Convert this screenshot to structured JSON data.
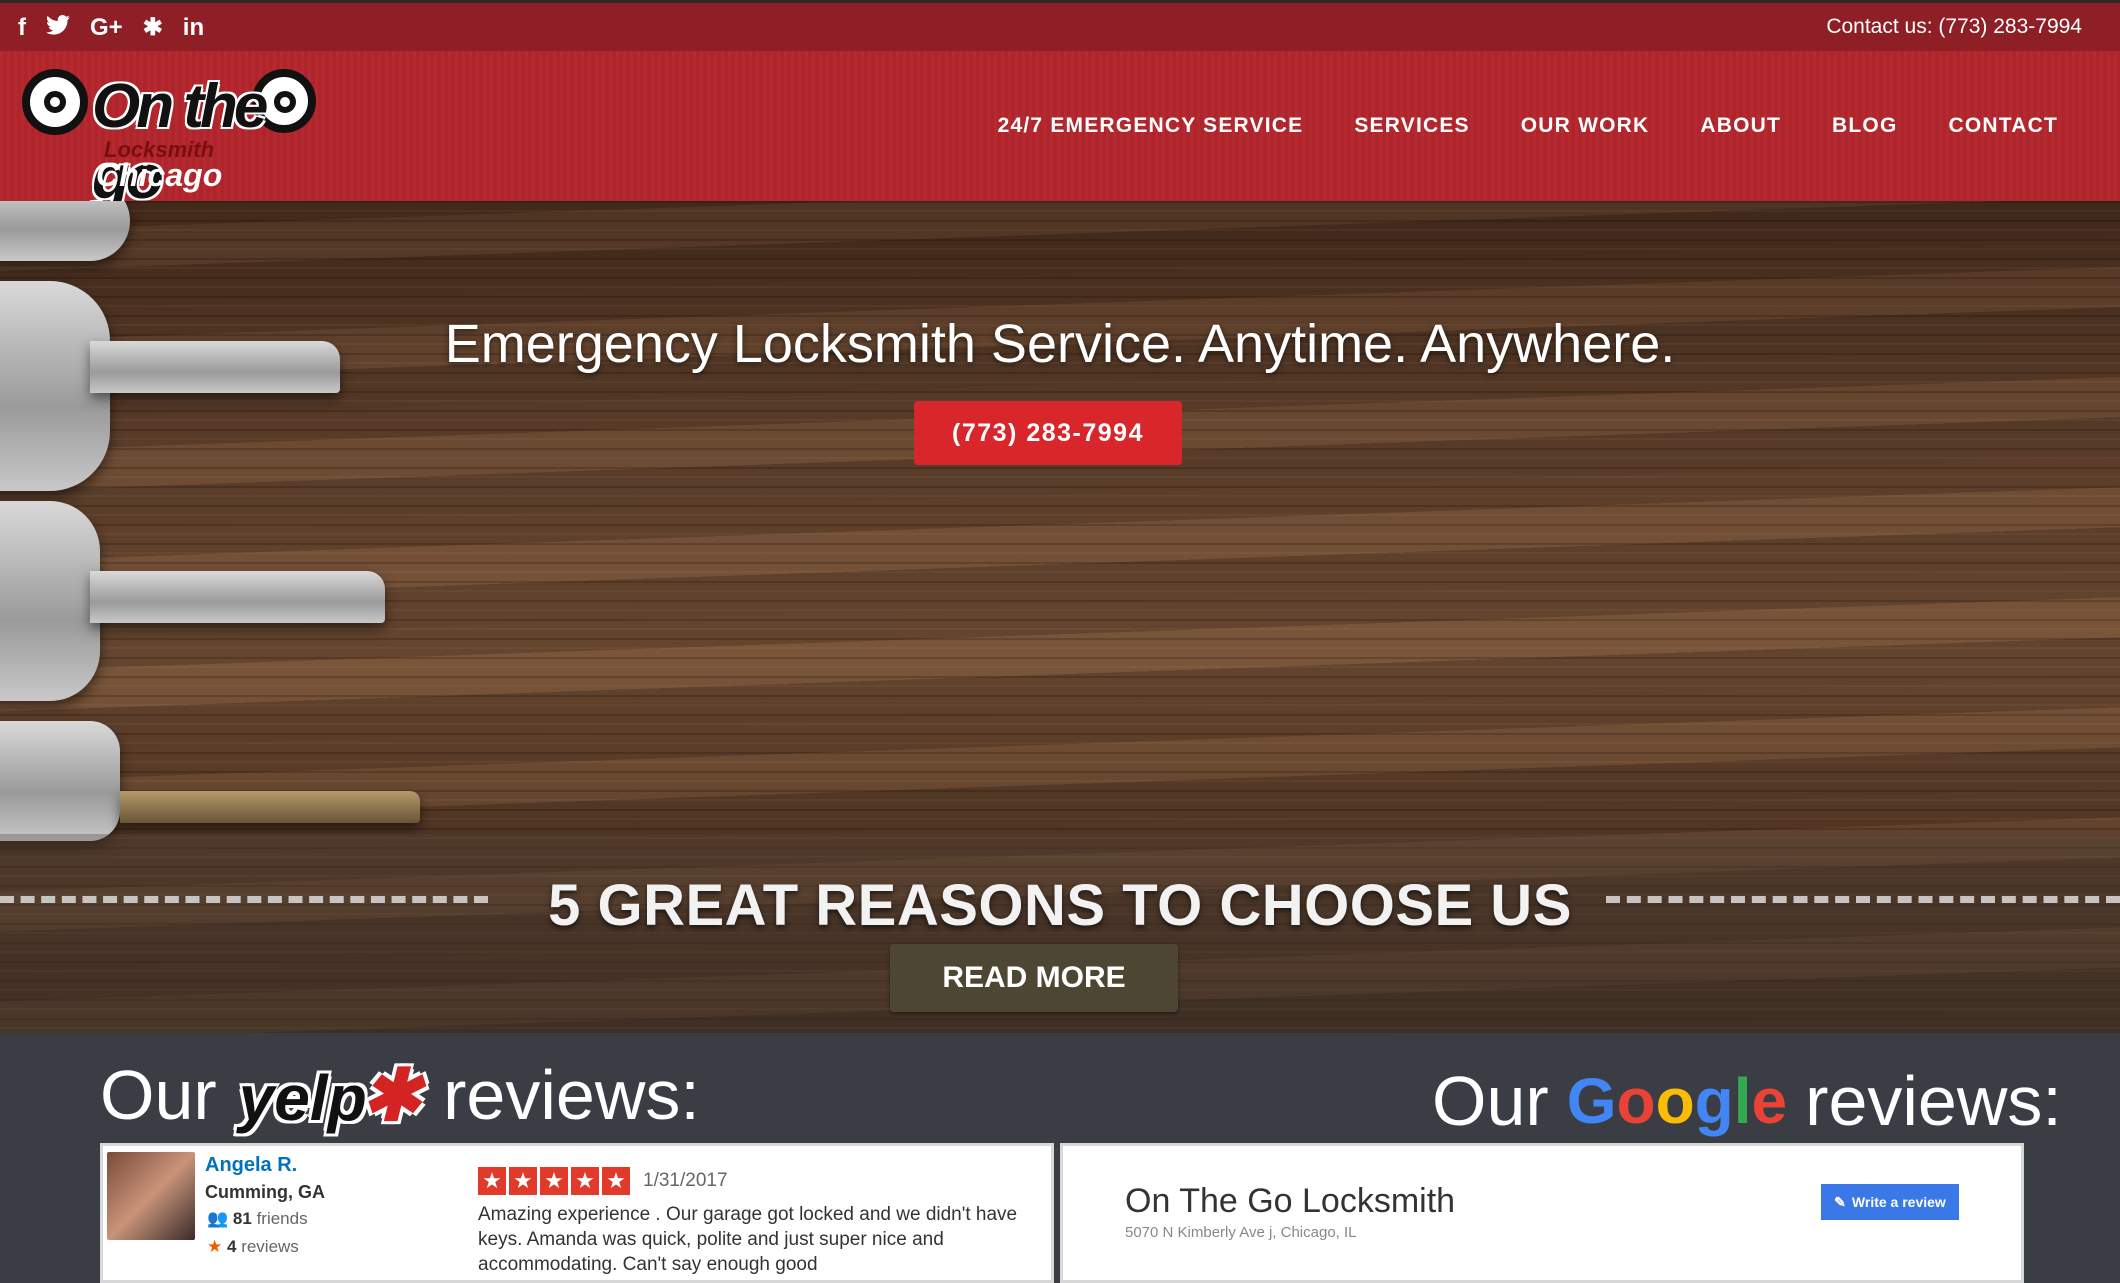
{
  "topbar": {
    "social": [
      {
        "icon": "facebook-icon",
        "glyph": "f"
      },
      {
        "icon": "twitter-icon",
        "glyph": "🐦"
      },
      {
        "icon": "google-plus-icon",
        "glyph": "G+"
      },
      {
        "icon": "yelp-icon",
        "glyph": "✱"
      },
      {
        "icon": "linkedin-icon",
        "glyph": "in"
      }
    ],
    "contact": "Contact us: (773) 283-7994"
  },
  "logo": {
    "wordmark": "On the go",
    "line2": "Locksmith",
    "line3": "Chicago"
  },
  "nav": {
    "items": [
      "24/7 EMERGENCY SERVICE",
      "SERVICES",
      "OUR WORK",
      "ABOUT",
      "BLOG",
      "CONTACT"
    ]
  },
  "hero": {
    "title": "Emergency Locksmith Service. Anytime. Anywhere.",
    "phone_button": "(773) 283-7994",
    "reasons_title": "5 GREAT REASONS TO CHOOSE US",
    "read_more": "READ MORE"
  },
  "reviews": {
    "yelp_heading_prefix": "Our",
    "yelp_logo": "yelp",
    "yelp_heading_suffix": "reviews:",
    "google_heading_prefix": "Our",
    "google_heading_suffix": "reviews:",
    "google_letters": [
      {
        "ch": "G",
        "color": "#4285f4"
      },
      {
        "ch": "o",
        "color": "#ea4335"
      },
      {
        "ch": "o",
        "color": "#fbbc05"
      },
      {
        "ch": "g",
        "color": "#4285f4"
      },
      {
        "ch": "l",
        "color": "#34a853"
      },
      {
        "ch": "e",
        "color": "#ea4335"
      }
    ],
    "yelp_review": {
      "name": "Angela R.",
      "location": "Cumming, GA",
      "friends_count": "81",
      "friends_label": "friends",
      "reviews_count": "4",
      "reviews_label": "reviews",
      "rating": 5,
      "date": "1/31/2017",
      "text": "Amazing experience . Our garage got locked and we didn't have keys. Amanda was quick, polite and just super nice and accommodating. Can't say enough good"
    },
    "google_card": {
      "business_name": "On The Go Locksmith",
      "address": "5070 N Kimberly Ave j, Chicago, IL",
      "write_review": "Write a review"
    }
  },
  "colors": {
    "topbar": "#8f1f26",
    "header": "#b3262c",
    "accent_button": "#d8262b",
    "reviews_bg": "#3a3e44"
  }
}
